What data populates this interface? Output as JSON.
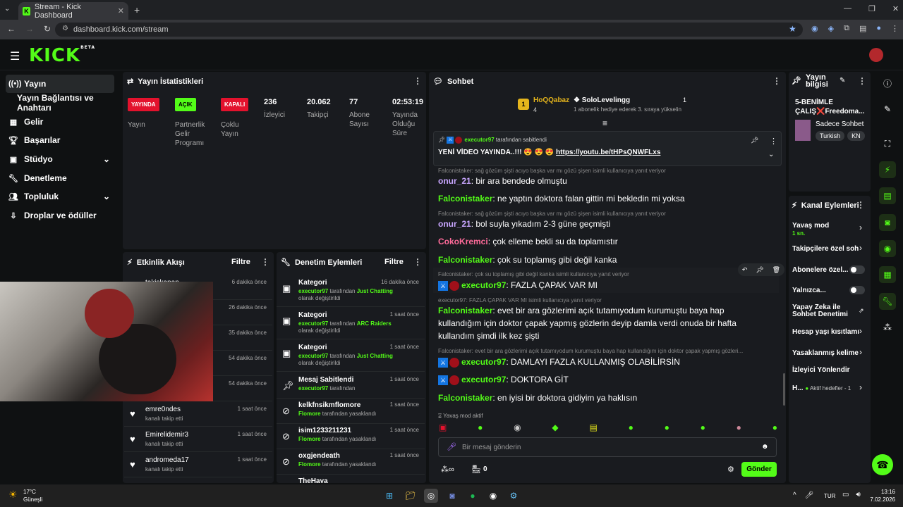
{
  "browser": {
    "tab_title": "Stream - Kick Dashboard",
    "url": "dashboard.kick.com/stream"
  },
  "logo": {
    "text": "KICK",
    "beta": "BETA"
  },
  "sidebar": {
    "items": [
      {
        "label": "Yayın",
        "icon": "broadcast-icon",
        "active": true
      },
      {
        "label": "Yayın Bağlantısı ve Anahtarı",
        "icon": ""
      },
      {
        "label": "Gelir",
        "icon": "revenue-icon"
      },
      {
        "label": "Başarılar",
        "icon": "trophy-icon"
      },
      {
        "label": "Stüdyo",
        "icon": "studio-icon",
        "chevron": true
      },
      {
        "label": "Denetleme",
        "icon": "wrench-icon"
      },
      {
        "label": "Topluluk",
        "icon": "community-icon",
        "chevron": true
      },
      {
        "label": "Droplar ve ödüller",
        "icon": "drops-icon"
      }
    ]
  },
  "stats": {
    "title": "Yayın İstatistikleri",
    "items": [
      {
        "badge": "YAYINDA",
        "badge_color": "#e3122d",
        "label": "Yayın"
      },
      {
        "badge": "AÇIK",
        "badge_color": "#53fc18",
        "label": "Partnerlik Gelir Programı"
      },
      {
        "badge": "KAPALI",
        "badge_color": "#e3122d",
        "label": "Çoklu Yayın"
      },
      {
        "value": "236",
        "label": "İzleyici"
      },
      {
        "value": "20.062",
        "label": "Takipçi"
      },
      {
        "value": "77",
        "label": "Abone Sayısı"
      },
      {
        "value": "02:53:19",
        "label": "Yayında Olduğu Süre"
      }
    ]
  },
  "activity": {
    "title": "Etkinlik Akışı",
    "filter": "Filtre",
    "items": [
      {
        "name": "takiskanan",
        "sub": "",
        "time": "6 dakika önce"
      },
      {
        "name": "",
        "sub": "",
        "time": "26 dakika önce"
      },
      {
        "name": "",
        "sub": "",
        "time": "35 dakika önce"
      },
      {
        "name": "",
        "sub": "",
        "time": "54 dakika önce"
      },
      {
        "name": "",
        "sub": "",
        "time": "54 dakika önce"
      },
      {
        "name": "emre0ndes",
        "sub": "kanalı takip etti",
        "time": "1 saat önce"
      },
      {
        "name": "Emirelidemir3",
        "sub": "kanalı takip etti",
        "time": "1 saat önce"
      },
      {
        "name": "andromeda17",
        "sub": "kanalı takip etti",
        "time": "1 saat önce"
      }
    ]
  },
  "modactions": {
    "title": "Denetim Eylemleri",
    "filter": "Filtre",
    "items": [
      {
        "title": "Kategori",
        "user": "executor97",
        "mid": " tarafından ",
        "cat": "Just Chatting",
        "end": " olarak değiştirildi",
        "time": "16 dakika önce"
      },
      {
        "title": "Kategori",
        "user": "executor97",
        "mid": " tarafından ",
        "cat": "ARC Raiders",
        "end": " olarak değiştirildi",
        "time": "1 saat önce"
      },
      {
        "title": "Kategori",
        "user": "executor97",
        "mid": " tarafından ",
        "cat": "Just Chatting",
        "end": " olarak değiştirildi",
        "time": "1 saat önce"
      },
      {
        "title": "Mesaj Sabitlendi",
        "user": "executor97",
        "mid": " tarafından",
        "cat": "",
        "end": "",
        "time": "1 saat önce"
      },
      {
        "title": "kelkfnsikmflomore",
        "user": "Flomore",
        "mid": " tarafından yasaklandı",
        "cat": "",
        "end": "",
        "time": "1 saat önce"
      },
      {
        "title": "isim1233211231",
        "user": "Flomore",
        "mid": " tarafından yasaklandı",
        "cat": "",
        "end": "",
        "time": "1 saat önce"
      },
      {
        "title": "oxgjendeath",
        "user": "Flomore",
        "mid": " tarafından yasaklandı",
        "cat": "",
        "end": "",
        "time": "1 saat önce"
      },
      {
        "title": "TheHaya",
        "user": "",
        "mid": "",
        "cat": "",
        "end": "",
        "time": ""
      }
    ]
  },
  "chat": {
    "title": "Sohbet",
    "leader1": {
      "name": "HoQQabaz",
      "count": "4"
    },
    "leader2": {
      "name": "SoloLevelingg",
      "count": "1",
      "note": "1 abonelik hediye ederek 3. sıraya yükselin"
    },
    "pinned": {
      "by": "executor97",
      "by_suffix": " tarafından sabitlendi",
      "text": "YENİ VİDEO YAYINDA..!!!",
      "emojis": "😍 😍 😍",
      "link": "https://youtu.be/tHPsQNWFLxs"
    },
    "messages": [
      {
        "reply": "Falconistaker: sağ gözüm şişti acıyo başka var mı gözü şişen isimli kullanıcıya yanıt veriyor",
        "user": "onur_21",
        "cls": "cp",
        "text": "bir ara bendede olmuştu"
      },
      {
        "reply": "",
        "user": "Falconistaker",
        "cls": "cgr",
        "text": "ne yaptın doktora falan gittin mi bekledin mi yoksa"
      },
      {
        "reply": "Falconistaker: sağ gözüm şişti acıyo başka var mı gözü şişen isimli kullanıcıya yanıt veriyor",
        "user": "onur_21",
        "cls": "cp",
        "text": "bol suyla yıkadım 2-3 güne geçmişti"
      },
      {
        "reply": "",
        "user": "CokoKremci",
        "cls": "cr",
        "text": "çok elleme bekli su da toplamıstır"
      },
      {
        "reply": "",
        "user": "Falconistaker",
        "cls": "cgr",
        "text": "çok su toplamış gibi değil kanka"
      },
      {
        "reply": "Falconistaker: çok su toplamış gibi değil kanka isimli kullanıcıya yanıt veriyor",
        "user": "executor97",
        "cls": "cg",
        "mod": true,
        "text": "FAZLA ÇAPAK VAR MI"
      },
      {
        "reply": "executor97: FAZLA ÇAPAK VAR MI isimli kullanıcıya yanıt veriyor",
        "user": "Falconistaker",
        "cls": "cgr",
        "text": "evet bir ara gözlerimi açık tutamıyodum kurumuştu baya hap kullandığım için doktor çapak yapmış gözlerin deyip damla verdi onuda bir hafta kullandım şimdi ilk kez şişti"
      },
      {
        "reply": "Falconistaker: evet bir ara gözlerimi açık tutamıyodum kurumuştu baya hap kullandığım için doktor çapak yapmış gözleri...",
        "user": "executor97",
        "cls": "cg",
        "mod": true,
        "text": "DAMLAYI FAZLA KULLANMIŞ OLABİLİRSİN"
      },
      {
        "reply": "",
        "user": "executor97",
        "cls": "cg",
        "mod": true,
        "text": "DOKTORA GİT"
      },
      {
        "reply": "",
        "user": "Falconistaker",
        "cls": "cgr",
        "text": "en iyisi bir doktora gidiyim ya haklısın"
      }
    ],
    "slow_mode": "Yavaş mod aktif",
    "input_placeholder": "Bir mesaj gönderin",
    "points": "0",
    "send": "Gönder"
  },
  "info": {
    "title": "Yayın bilgisi",
    "stream_title": "5-BENİMLE ÇALIŞ❌Freedoma...",
    "category": "Sadece Sohbet",
    "tags": [
      "Turkish",
      "KN"
    ]
  },
  "actions": {
    "title": "Kanal Eylemleri",
    "items": [
      {
        "label": "Yavaş mod",
        "sub": "1 sn.",
        "type": "chevron"
      },
      {
        "label": "Takipçilere özel soh",
        "type": "chevron"
      },
      {
        "label": "Abonelere özel...",
        "type": "toggle"
      },
      {
        "label": "Yalnızca...",
        "type": "toggle"
      },
      {
        "label": "Yapay Zeka ile Sohbet Denetimi",
        "type": "ext"
      },
      {
        "label": "Hesap yaşı kısıtlamı",
        "type": "chevron"
      },
      {
        "label": "Yasaklanmış kelime",
        "type": "chevron"
      },
      {
        "label": "İzleyici Yönlendir",
        "type": "none"
      },
      {
        "label": "H...",
        "sub": "Aktif hedefler - 1",
        "type": "chevron"
      }
    ]
  },
  "taskbar": {
    "weather_temp": "17°C",
    "weather_text": "Güneşli",
    "lang": "TUR",
    "time": "13:16",
    "date": "7.02.2026"
  }
}
